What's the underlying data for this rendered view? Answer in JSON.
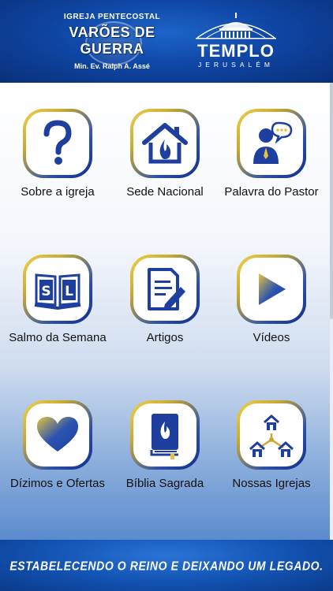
{
  "header": {
    "logo_left": {
      "top": "IGREJA PENTECOSTAL",
      "main": "VARÕES DE GUERRA",
      "sub": "Min. Ev. Ralph A. Assé"
    },
    "logo_right": {
      "title": "TEMPLO",
      "subtitle": "JERUSALÉM"
    }
  },
  "menu": {
    "items": [
      {
        "label": "Sobre a igreja",
        "icon": "question-icon"
      },
      {
        "label": "Sede Nacional",
        "icon": "house-flame-icon"
      },
      {
        "label": "Palavra do Pastor",
        "icon": "pastor-speech-icon"
      },
      {
        "label": "Salmo da Semana",
        "icon": "open-book-sl-icon"
      },
      {
        "label": "Artigos",
        "icon": "document-pen-icon"
      },
      {
        "label": "Vídeos",
        "icon": "play-icon"
      },
      {
        "label": "Dízimos e Ofertas",
        "icon": "heart-icon"
      },
      {
        "label": "Bíblia Sagrada",
        "icon": "bible-icon"
      },
      {
        "label": "Nossas Igrejas",
        "icon": "church-network-icon"
      }
    ]
  },
  "footer": {
    "slogan": "ESTABELECENDO O REINO E DEIXANDO UM LEGADO."
  },
  "colors": {
    "primary_blue": "#0f47a6",
    "gold": "#e3c340",
    "icon_blue": "#1f3f9e"
  }
}
